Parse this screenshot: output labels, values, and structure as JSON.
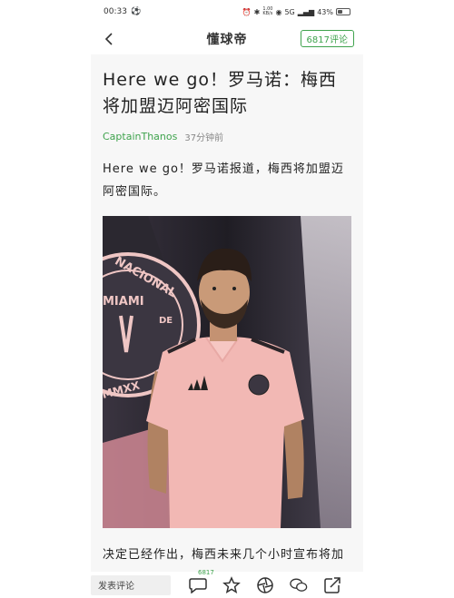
{
  "status": {
    "time": "00:33",
    "speed": "1.00",
    "speed_unit": "KB/s",
    "network": "5G",
    "battery": "43%",
    "battery_level": 0.43
  },
  "nav": {
    "logo": "懂球帝",
    "comment_button": "6817评论"
  },
  "article": {
    "headline": "Here we go！罗马诺：梅西将加盟迈阿密国际",
    "author": "CaptainThanos",
    "time": "37分钟前",
    "lead": "Here we go！罗马诺报道，梅西将加盟迈阿密国际。",
    "photo": {
      "crest_text": [
        "NACIONAL",
        "DE",
        "MIAMI",
        "MMXX"
      ]
    },
    "paragraph": "决定已经作出，梅西未来几个小时宣布将加"
  },
  "bottom": {
    "comment_placeholder": "发表评论",
    "comment_badge": "6817"
  },
  "colors": {
    "accent": "#3fa34d",
    "jersey": "#f2b8b4",
    "crest": "#efc6c4"
  }
}
